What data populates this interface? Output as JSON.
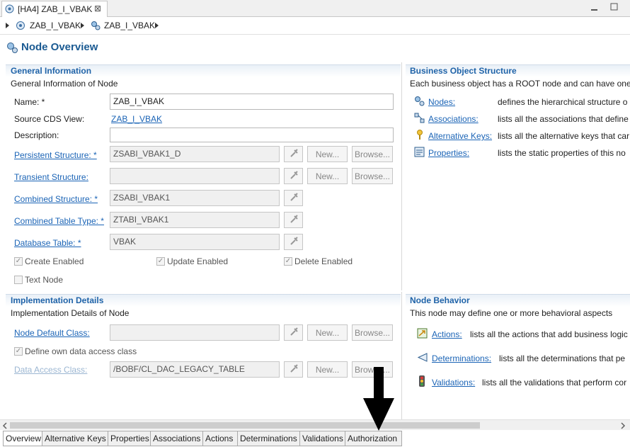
{
  "editor_tab": {
    "title": "[HA4] ZAB_I_VBAK",
    "close": "⊠"
  },
  "window": {
    "minimize": "☐",
    "maximize": "☐"
  },
  "breadcrumb": {
    "item1": "ZAB_I_VBAK",
    "item2": "ZAB_I_VBAK"
  },
  "page_title": "Node Overview",
  "general": {
    "title": "General Information",
    "desc": "General Information of Node",
    "name_label": "Name: *",
    "name_value": "ZAB_I_VBAK",
    "source_label": "Source CDS View:",
    "source_link": "ZAB_I_VBAK",
    "description_label": "Description:",
    "description_value": "",
    "persistent_label": "Persistent Structure: *",
    "persistent_value": "ZSABI_VBAK1_D",
    "transient_label": "Transient Structure:",
    "transient_value": "",
    "combined_label": "Combined Structure: *",
    "combined_value": "ZSABI_VBAK1",
    "table_type_label": "Combined Table Type: *",
    "table_type_value": "ZTABI_VBAK1",
    "db_table_label": "Database Table: *",
    "db_table_value": "VBAK",
    "new_label": "New...",
    "browse_label": "Browse...",
    "create_enabled": "Create Enabled",
    "update_enabled": "Update Enabled",
    "delete_enabled": "Delete Enabled",
    "text_node": "Text Node"
  },
  "bo_structure": {
    "title": "Business Object Structure",
    "desc": "Each business object has a ROOT node and can have one o",
    "nodes_link": "Nodes:",
    "nodes_desc": "defines the hierarchical structure o",
    "assoc_link": "Associations:",
    "assoc_desc": "lists all the associations that define",
    "altkeys_link": "Alternative Keys:",
    "altkeys_desc": "lists all the alternative keys that car",
    "props_link": "Properties:",
    "props_desc": "lists the static properties of this no"
  },
  "implementation": {
    "title": "Implementation Details",
    "desc": "Implementation Details of Node",
    "default_class_label": "Node Default Class:",
    "default_class_value": "",
    "own_access": "Define own data access class",
    "access_class_label": "Data Access Class:",
    "access_class_value": "/BOBF/CL_DAC_LEGACY_TABLE",
    "new_label": "New...",
    "browse_label": "Browse..."
  },
  "behavior": {
    "title": "Node Behavior",
    "desc": "This node may define one or more behavioral aspects",
    "actions_link": "Actions:",
    "actions_desc": "lists all the actions that add business logic",
    "determinations_link": "Determinations:",
    "determinations_desc": "lists all the determinations that pe",
    "validations_link": "Validations:",
    "validations_desc": "lists all the validations that perform cor"
  },
  "bottom_tabs": [
    "Overview",
    "Alternative Keys",
    "Properties",
    "Associations",
    "Actions",
    "Determinations",
    "Validations",
    "Authorization"
  ],
  "check_mark": "✓"
}
